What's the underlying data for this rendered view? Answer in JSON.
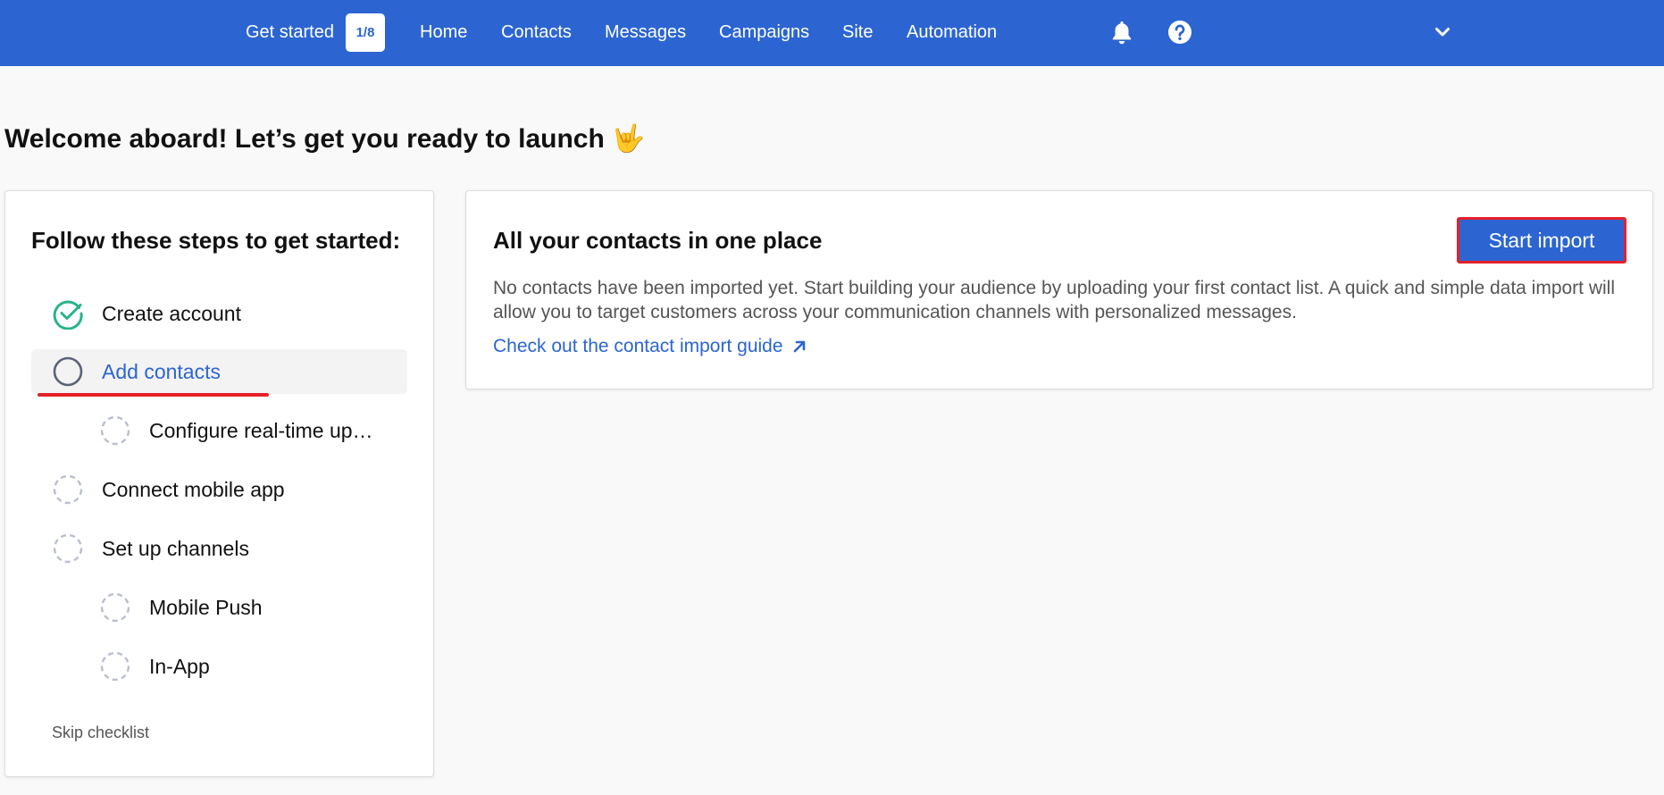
{
  "nav": {
    "get_started_label": "Get started",
    "progress": "1/8",
    "items": [
      {
        "label": "Home"
      },
      {
        "label": "Contacts"
      },
      {
        "label": "Messages"
      },
      {
        "label": "Campaigns"
      },
      {
        "label": "Site"
      },
      {
        "label": "Automation"
      }
    ],
    "icons": [
      "bell-icon",
      "help-icon",
      "chevron-down-icon"
    ]
  },
  "page": {
    "title": "Welcome aboard! Let’s get you ready to launch",
    "emoji": "🤟"
  },
  "steps": {
    "title": "Follow these steps to get started:",
    "items": [
      {
        "label": "Create account",
        "status": "done"
      },
      {
        "label": "Add contacts",
        "status": "active"
      },
      {
        "label": "Configure real-time up…",
        "status": "pending"
      },
      {
        "label": "Connect mobile app",
        "status": "pending"
      },
      {
        "label": "Set up channels",
        "status": "pending"
      },
      {
        "label": "Mobile Push",
        "status": "pending"
      },
      {
        "label": "In-App",
        "status": "pending"
      }
    ],
    "skip_label": "Skip checklist"
  },
  "contacts_card": {
    "title": "All your contacts in one place",
    "description": "No contacts have been imported yet. Start building your audience by uploading your first contact list. A quick and simple data import will allow you to target customers across your communication channels with personalized messages.",
    "guide_link": "Check out the contact import guide",
    "button_label": "Start import"
  },
  "colors": {
    "brand": "#2c65d1",
    "done": "#27b38a",
    "highlight": "#e5202b"
  }
}
